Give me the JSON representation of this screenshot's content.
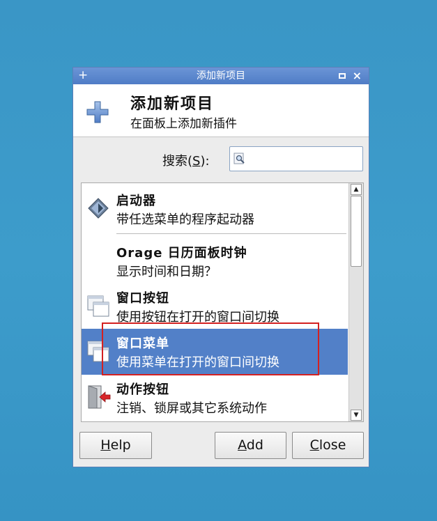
{
  "window": {
    "title": "添加新项目",
    "menu_glyph": "+",
    "close_glyph": "×"
  },
  "header": {
    "title": "添加新项目",
    "subtitle": "在面板上添加新插件"
  },
  "search": {
    "label_prefix": "搜索(",
    "label_mnemonic": "S",
    "label_suffix": "):",
    "value": ""
  },
  "items": [
    {
      "name": "启动器",
      "desc": "带任选菜单的程序起动器",
      "icon": "launcher-icon",
      "selected": false
    },
    {
      "name": "Orage 日历面板时钟",
      "desc": "显示时间和日期？",
      "icon": "none",
      "selected": false
    },
    {
      "name": "窗口按钮",
      "desc": "使用按钮在打开的窗口间切换",
      "icon": "window-buttons-icon",
      "selected": false
    },
    {
      "name": "窗口菜单",
      "desc": "使用菜单在打开的窗口间切换",
      "icon": "window-menu-icon",
      "selected": true
    },
    {
      "name": "动作按钮",
      "desc": "注销、锁屏或其它系统动作",
      "icon": "action-buttons-icon",
      "selected": false
    }
  ],
  "buttons": {
    "help_mnemonic": "H",
    "help_rest": "elp",
    "add_mnemonic": "A",
    "add_rest": "dd",
    "close_mnemonic": "C",
    "close_rest": "lose"
  },
  "colors": {
    "titlebar": "#4f7cc6",
    "selection": "#5280c8",
    "highlight_border": "#d42020"
  }
}
